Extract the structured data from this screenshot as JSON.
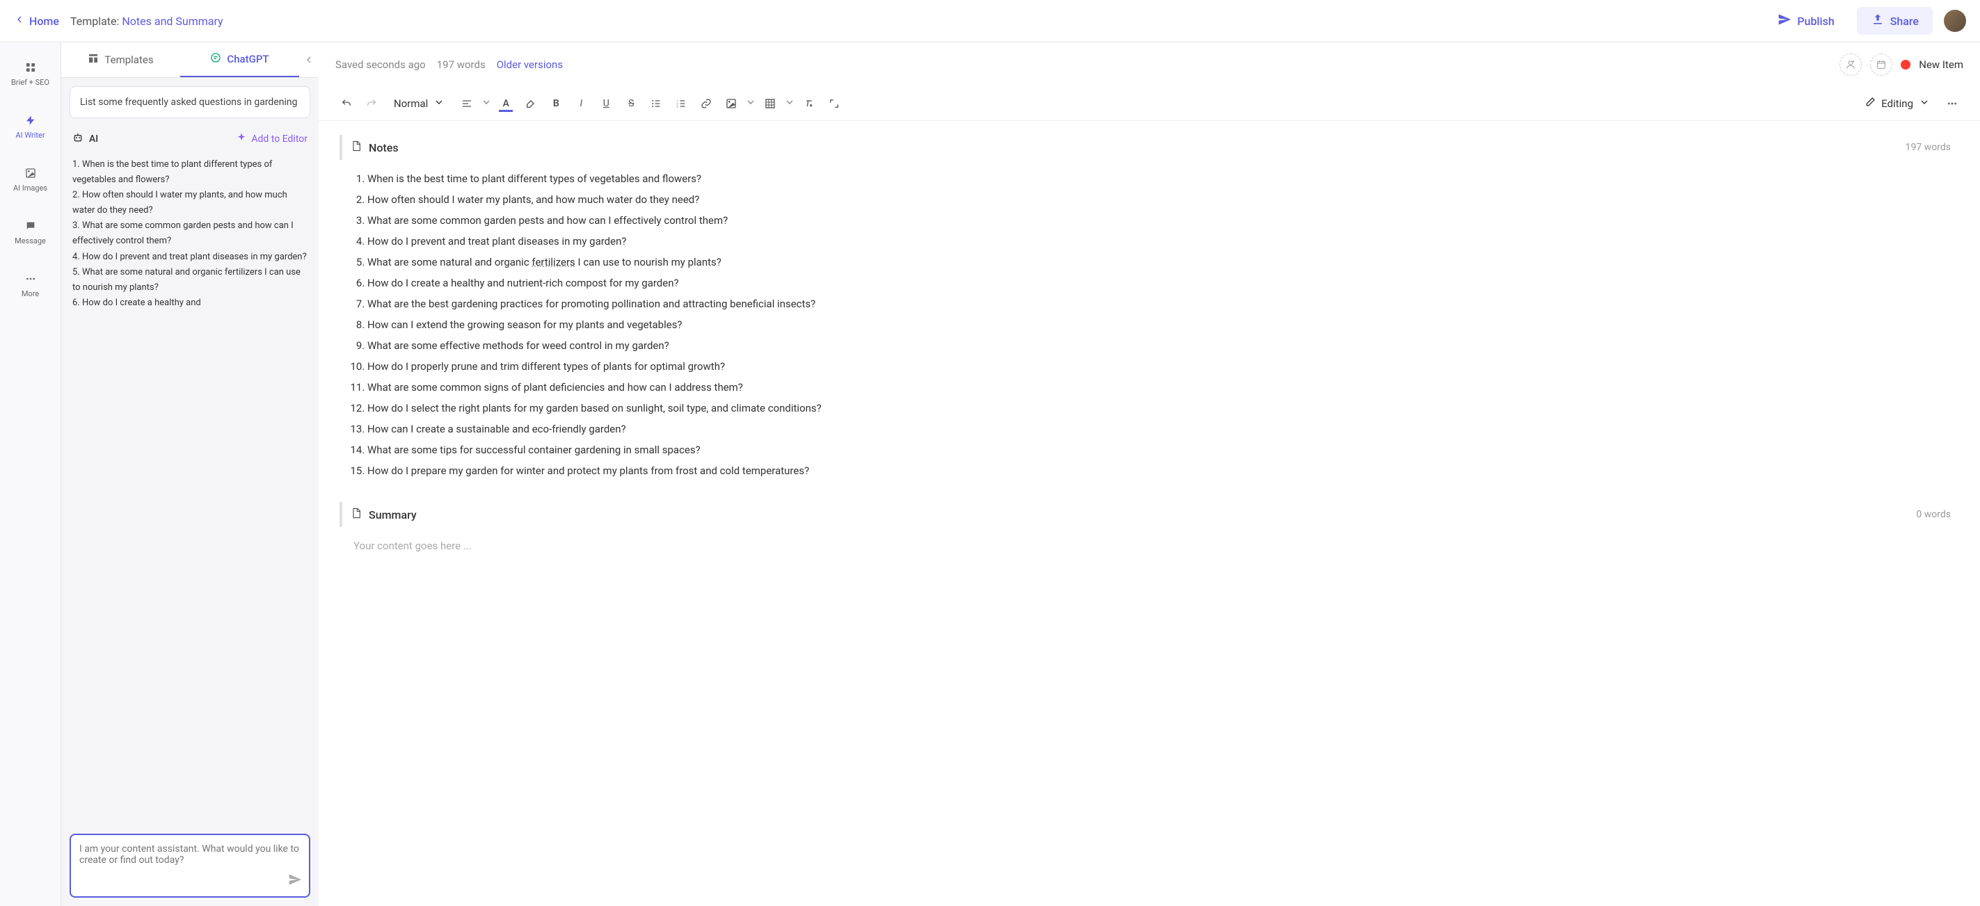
{
  "header": {
    "home": "Home",
    "template_label": "Template: ",
    "template_name": "Notes and Summary",
    "publish": "Publish",
    "share": "Share"
  },
  "leftnav": {
    "items": [
      {
        "label": "Brief + SEO"
      },
      {
        "label": "AI Writer"
      },
      {
        "label": "AI Images"
      },
      {
        "label": "Message"
      },
      {
        "label": "More"
      }
    ]
  },
  "sidebar": {
    "tabs": {
      "templates": "Templates",
      "chatgpt": "ChatGPT"
    },
    "prompt": "List some frequently asked questions in gardening",
    "ai_label": "AI",
    "add_to_editor": "Add to Editor",
    "ai_response": "1. When is the best time to plant different types of vegetables and flowers?\n2. How often should I water my plants, and how much water do they need?\n3. What are some common garden pests and how can I effectively control them?\n4. How do I prevent and treat plant diseases in my garden?\n5. What are some natural and organic fertilizers I can use to nourish my plants?\n6. How do I create a healthy and",
    "chat_placeholder": "I am your content assistant. What would you like to create or find out today?"
  },
  "editor": {
    "saved": "Saved seconds ago",
    "word_count_top": "197 words",
    "older_versions": "Older versions",
    "status": "New Item",
    "style_select": "Normal",
    "mode": "Editing"
  },
  "sections": {
    "notes": {
      "title": "Notes",
      "count": "197 words",
      "items": [
        "When is the best time to plant different types of vegetables and flowers?",
        "How often should I water my plants, and how much water do they need?",
        "What are some common garden pests and how can I effectively control them?",
        "How do I prevent and treat plant diseases in my garden?",
        "What are some natural and organic fertilizers I can use to nourish my plants?",
        "How do I create a healthy and nutrient-rich compost for my garden?",
        "What are the best gardening practices for promoting pollination and attracting beneficial insects?",
        "How can I extend the growing season for my plants and vegetables?",
        "What are some effective methods for weed control in my garden?",
        "How do I properly prune and trim different types of plants for optimal growth?",
        "What are some common signs of plant deficiencies and how can I address them?",
        "How do I select the right plants for my garden based on sunlight, soil type, and climate conditions?",
        "How can I create a sustainable and eco-friendly garden?",
        "What are some tips for successful container gardening in small spaces?",
        "How do I prepare my garden for winter and protect my plants from frost and cold temperatures?"
      ]
    },
    "summary": {
      "title": "Summary",
      "count": "0 words",
      "placeholder": "Your content goes here ..."
    }
  }
}
